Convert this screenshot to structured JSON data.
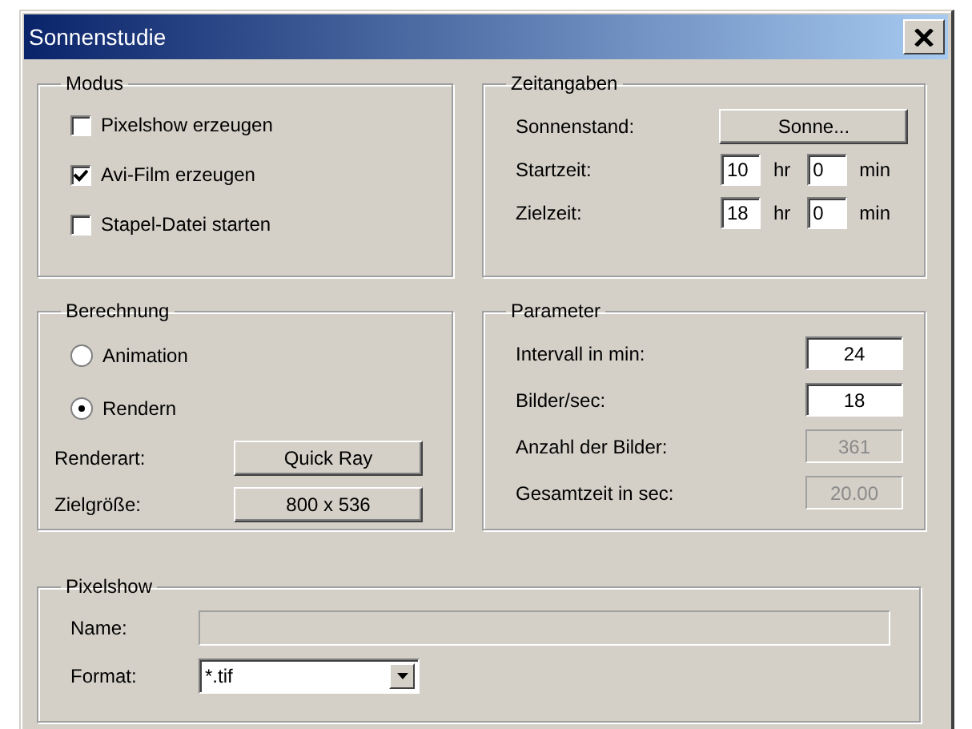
{
  "window": {
    "title": "Sonnenstudie"
  },
  "modus": {
    "title": "Modus",
    "options": [
      {
        "label": "Pixelshow erzeugen",
        "checked": false
      },
      {
        "label": "Avi-Film erzeugen",
        "checked": true
      },
      {
        "label": "Stapel-Datei starten",
        "checked": false
      }
    ]
  },
  "zeitangaben": {
    "title": "Zeitangaben",
    "sonnenstand": {
      "label": "Sonnenstand:",
      "button": "Sonne..."
    },
    "times": [
      {
        "label": "Startzeit:",
        "hours": "10",
        "hours_unit": "hr",
        "minutes": "0",
        "minutes_unit": "min"
      },
      {
        "label": "Zielzeit:",
        "hours": "18",
        "hours_unit": "hr",
        "minutes": "0",
        "minutes_unit": "min"
      }
    ]
  },
  "berechnung": {
    "title": "Berechnung",
    "modes": [
      {
        "label": "Animation",
        "selected": false
      },
      {
        "label": "Rendern",
        "selected": true
      }
    ],
    "rows": [
      {
        "label": "Renderart:",
        "button": "Quick Ray"
      },
      {
        "label": "Zielgröße:",
        "button": "800 x 536"
      }
    ]
  },
  "parameter": {
    "title": "Parameter",
    "fields": [
      {
        "label": "Intervall in min:",
        "value": "24",
        "disabled": false
      },
      {
        "label": "Bilder/sec:",
        "value": "18",
        "disabled": false
      },
      {
        "label": "Anzahl der Bilder:",
        "value": "361",
        "disabled": true
      },
      {
        "label": "Gesamtzeit in sec:",
        "value": "20.00",
        "disabled": true
      }
    ]
  },
  "pixelshow": {
    "title": "Pixelshow",
    "name": {
      "label": "Name:",
      "disabled": true
    },
    "format": {
      "label": "Format:",
      "value": "*.tif"
    }
  }
}
